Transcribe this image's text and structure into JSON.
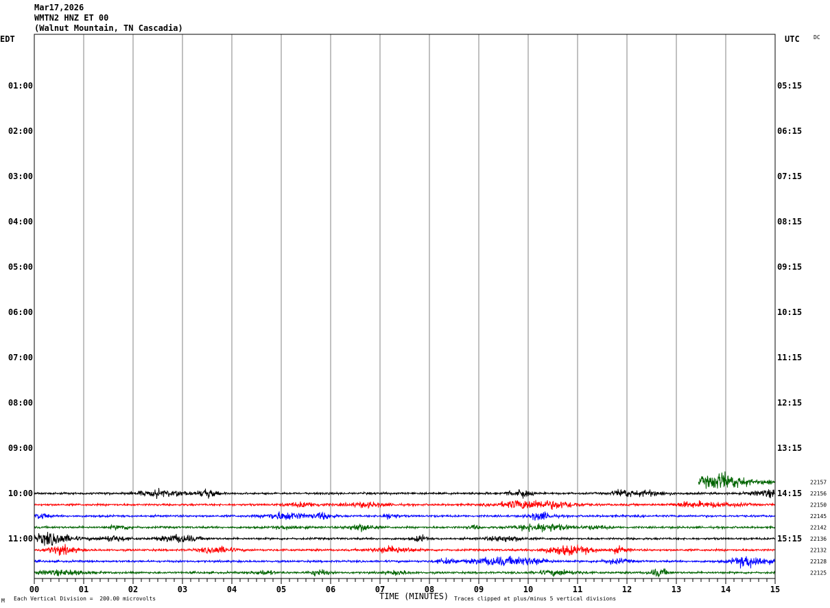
{
  "header": {
    "date": "Mar17,2026",
    "station": "WMTN2 HNZ ET 00",
    "location": "(Walnut Mountain, TN Cascadia)"
  },
  "left_axis_title": "EDT",
  "right_axis_title": "UTC",
  "corner_label": "DC",
  "footer": {
    "scale_note": "Each Vertical Division =  200.00 microvolts",
    "xlabel": "TIME (MINUTES)",
    "clip_note": "Traces clipped at plus/minus 5 vertical divisions",
    "tiny_mark": "M"
  },
  "chart_data": {
    "type": "line",
    "title": "WMTN2 HNZ ET 00",
    "xlabel": "TIME (MINUTES)",
    "ylabel": "",
    "x_ticks": [
      "00",
      "01",
      "02",
      "03",
      "04",
      "05",
      "06",
      "07",
      "08",
      "09",
      "10",
      "11",
      "12",
      "13",
      "14",
      "15"
    ],
    "xlim": [
      0,
      15
    ],
    "hour_labels_edt": [
      "01:00",
      "02:00",
      "03:00",
      "04:00",
      "05:00",
      "06:00",
      "07:00",
      "08:00",
      "09:00",
      "10:00",
      "11:00"
    ],
    "hour_labels_utc": [
      "05:15",
      "06:15",
      "07:15",
      "08:15",
      "09:15",
      "10:15",
      "11:15",
      "12:15",
      "13:15",
      "14:15",
      "15:15"
    ],
    "rows_per_hour": 4,
    "total_rows": 47,
    "grid": true,
    "series": [
      {
        "row": 43,
        "color": "#000000",
        "start_min": 0,
        "end_min": 15,
        "count_label": "22156"
      },
      {
        "row": 44,
        "color": "#ff0000",
        "start_min": 0,
        "end_min": 15,
        "count_label": "22150"
      },
      {
        "row": 45,
        "color": "#0000ff",
        "start_min": 0,
        "end_min": 15,
        "count_label": "22145"
      },
      {
        "row": 46,
        "color": "#006400",
        "start_min": 0,
        "end_min": 15,
        "count_label": "22142"
      },
      {
        "row": 47,
        "color": "#000000",
        "start_min": 0,
        "end_min": 15,
        "count_label": "22136"
      },
      {
        "row": 48,
        "color": "#ff0000",
        "start_min": 0,
        "end_min": 15,
        "count_label": "22132"
      },
      {
        "row": 49,
        "color": "#0000ff",
        "start_min": 0,
        "end_min": 15,
        "count_label": "22128"
      },
      {
        "row": 50,
        "color": "#006400",
        "start_min": 0,
        "end_min": 15,
        "count_label": "22125"
      },
      {
        "row": 42,
        "color": "#006400",
        "start_min": 13.45,
        "end_min": 15,
        "count_label": "22157"
      }
    ]
  }
}
